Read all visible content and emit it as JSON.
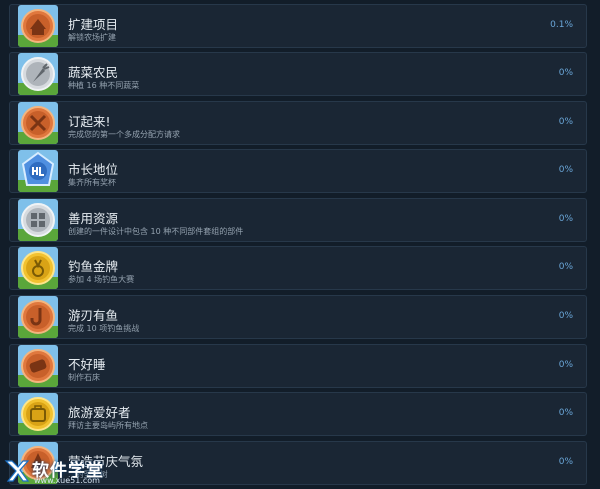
{
  "achievements": [
    {
      "title": "扩建项目",
      "description": "解锁农场扩建",
      "percent": "0.1%",
      "icon": "house-icon",
      "medal": "bronze"
    },
    {
      "title": "蔬菜农民",
      "description": "种植 16 种不同蔬菜",
      "percent": "0%",
      "icon": "carrot-icon",
      "medal": "silver"
    },
    {
      "title": "订起来!",
      "description": "完成您的第一个多成分配方请求",
      "percent": "0%",
      "icon": "utensils-icon",
      "medal": "bronze"
    },
    {
      "title": "市长地位",
      "description": "集齐所有奖杯",
      "percent": "0%",
      "icon": "crest-icon",
      "medal": "blue"
    },
    {
      "title": "善用资源",
      "description": "创建的一件设计中包含 10 种不同部件套组的部件",
      "percent": "0%",
      "icon": "puzzle-icon",
      "medal": "silver"
    },
    {
      "title": "钓鱼金牌",
      "description": "参加 4 场钓鱼大赛",
      "percent": "0%",
      "icon": "gold-medal-icon",
      "medal": "gold"
    },
    {
      "title": "游刃有鱼",
      "description": "完成 10 项钓鱼挑战",
      "percent": "0%",
      "icon": "fishhook-icon",
      "medal": "bronze"
    },
    {
      "title": "不好睡",
      "description": "制作石床",
      "percent": "0%",
      "icon": "stone-bed-icon",
      "medal": "bronze"
    },
    {
      "title": "旅游爱好者",
      "description": "拜访主要岛屿所有地点",
      "percent": "0%",
      "icon": "suitcase-icon",
      "medal": "gold"
    },
    {
      "title": "营造节庆气氛",
      "description": "...的圣诞树",
      "percent": "0%",
      "icon": "tree-icon",
      "medal": "bronze"
    }
  ],
  "watermark": {
    "name": "软件学堂",
    "url": "www.xue51.com"
  }
}
